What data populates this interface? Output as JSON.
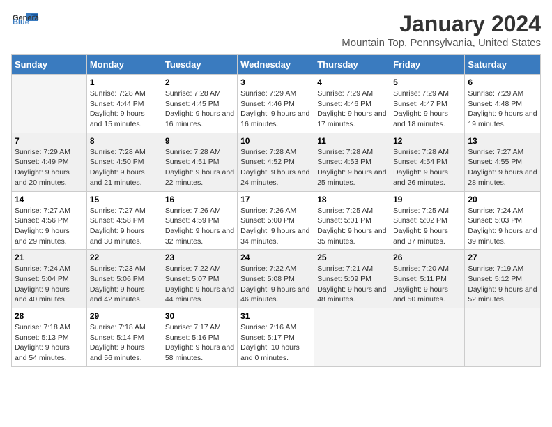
{
  "logo": {
    "general": "General",
    "blue": "Blue"
  },
  "title": "January 2024",
  "location": "Mountain Top, Pennsylvania, United States",
  "days_of_week": [
    "Sunday",
    "Monday",
    "Tuesday",
    "Wednesday",
    "Thursday",
    "Friday",
    "Saturday"
  ],
  "weeks": [
    [
      {
        "day": "",
        "empty": true
      },
      {
        "day": "1",
        "sunrise": "Sunrise: 7:28 AM",
        "sunset": "Sunset: 4:44 PM",
        "daylight": "Daylight: 9 hours and 15 minutes."
      },
      {
        "day": "2",
        "sunrise": "Sunrise: 7:28 AM",
        "sunset": "Sunset: 4:45 PM",
        "daylight": "Daylight: 9 hours and 16 minutes."
      },
      {
        "day": "3",
        "sunrise": "Sunrise: 7:29 AM",
        "sunset": "Sunset: 4:46 PM",
        "daylight": "Daylight: 9 hours and 16 minutes."
      },
      {
        "day": "4",
        "sunrise": "Sunrise: 7:29 AM",
        "sunset": "Sunset: 4:46 PM",
        "daylight": "Daylight: 9 hours and 17 minutes."
      },
      {
        "day": "5",
        "sunrise": "Sunrise: 7:29 AM",
        "sunset": "Sunset: 4:47 PM",
        "daylight": "Daylight: 9 hours and 18 minutes."
      },
      {
        "day": "6",
        "sunrise": "Sunrise: 7:29 AM",
        "sunset": "Sunset: 4:48 PM",
        "daylight": "Daylight: 9 hours and 19 minutes."
      }
    ],
    [
      {
        "day": "7",
        "sunrise": "Sunrise: 7:29 AM",
        "sunset": "Sunset: 4:49 PM",
        "daylight": "Daylight: 9 hours and 20 minutes."
      },
      {
        "day": "8",
        "sunrise": "Sunrise: 7:28 AM",
        "sunset": "Sunset: 4:50 PM",
        "daylight": "Daylight: 9 hours and 21 minutes."
      },
      {
        "day": "9",
        "sunrise": "Sunrise: 7:28 AM",
        "sunset": "Sunset: 4:51 PM",
        "daylight": "Daylight: 9 hours and 22 minutes."
      },
      {
        "day": "10",
        "sunrise": "Sunrise: 7:28 AM",
        "sunset": "Sunset: 4:52 PM",
        "daylight": "Daylight: 9 hours and 24 minutes."
      },
      {
        "day": "11",
        "sunrise": "Sunrise: 7:28 AM",
        "sunset": "Sunset: 4:53 PM",
        "daylight": "Daylight: 9 hours and 25 minutes."
      },
      {
        "day": "12",
        "sunrise": "Sunrise: 7:28 AM",
        "sunset": "Sunset: 4:54 PM",
        "daylight": "Daylight: 9 hours and 26 minutes."
      },
      {
        "day": "13",
        "sunrise": "Sunrise: 7:27 AM",
        "sunset": "Sunset: 4:55 PM",
        "daylight": "Daylight: 9 hours and 28 minutes."
      }
    ],
    [
      {
        "day": "14",
        "sunrise": "Sunrise: 7:27 AM",
        "sunset": "Sunset: 4:56 PM",
        "daylight": "Daylight: 9 hours and 29 minutes."
      },
      {
        "day": "15",
        "sunrise": "Sunrise: 7:27 AM",
        "sunset": "Sunset: 4:58 PM",
        "daylight": "Daylight: 9 hours and 30 minutes."
      },
      {
        "day": "16",
        "sunrise": "Sunrise: 7:26 AM",
        "sunset": "Sunset: 4:59 PM",
        "daylight": "Daylight: 9 hours and 32 minutes."
      },
      {
        "day": "17",
        "sunrise": "Sunrise: 7:26 AM",
        "sunset": "Sunset: 5:00 PM",
        "daylight": "Daylight: 9 hours and 34 minutes."
      },
      {
        "day": "18",
        "sunrise": "Sunrise: 7:25 AM",
        "sunset": "Sunset: 5:01 PM",
        "daylight": "Daylight: 9 hours and 35 minutes."
      },
      {
        "day": "19",
        "sunrise": "Sunrise: 7:25 AM",
        "sunset": "Sunset: 5:02 PM",
        "daylight": "Daylight: 9 hours and 37 minutes."
      },
      {
        "day": "20",
        "sunrise": "Sunrise: 7:24 AM",
        "sunset": "Sunset: 5:03 PM",
        "daylight": "Daylight: 9 hours and 39 minutes."
      }
    ],
    [
      {
        "day": "21",
        "sunrise": "Sunrise: 7:24 AM",
        "sunset": "Sunset: 5:04 PM",
        "daylight": "Daylight: 9 hours and 40 minutes."
      },
      {
        "day": "22",
        "sunrise": "Sunrise: 7:23 AM",
        "sunset": "Sunset: 5:06 PM",
        "daylight": "Daylight: 9 hours and 42 minutes."
      },
      {
        "day": "23",
        "sunrise": "Sunrise: 7:22 AM",
        "sunset": "Sunset: 5:07 PM",
        "daylight": "Daylight: 9 hours and 44 minutes."
      },
      {
        "day": "24",
        "sunrise": "Sunrise: 7:22 AM",
        "sunset": "Sunset: 5:08 PM",
        "daylight": "Daylight: 9 hours and 46 minutes."
      },
      {
        "day": "25",
        "sunrise": "Sunrise: 7:21 AM",
        "sunset": "Sunset: 5:09 PM",
        "daylight": "Daylight: 9 hours and 48 minutes."
      },
      {
        "day": "26",
        "sunrise": "Sunrise: 7:20 AM",
        "sunset": "Sunset: 5:11 PM",
        "daylight": "Daylight: 9 hours and 50 minutes."
      },
      {
        "day": "27",
        "sunrise": "Sunrise: 7:19 AM",
        "sunset": "Sunset: 5:12 PM",
        "daylight": "Daylight: 9 hours and 52 minutes."
      }
    ],
    [
      {
        "day": "28",
        "sunrise": "Sunrise: 7:18 AM",
        "sunset": "Sunset: 5:13 PM",
        "daylight": "Daylight: 9 hours and 54 minutes."
      },
      {
        "day": "29",
        "sunrise": "Sunrise: 7:18 AM",
        "sunset": "Sunset: 5:14 PM",
        "daylight": "Daylight: 9 hours and 56 minutes."
      },
      {
        "day": "30",
        "sunrise": "Sunrise: 7:17 AM",
        "sunset": "Sunset: 5:16 PM",
        "daylight": "Daylight: 9 hours and 58 minutes."
      },
      {
        "day": "31",
        "sunrise": "Sunrise: 7:16 AM",
        "sunset": "Sunset: 5:17 PM",
        "daylight": "Daylight: 10 hours and 0 minutes."
      },
      {
        "day": "",
        "empty": true
      },
      {
        "day": "",
        "empty": true
      },
      {
        "day": "",
        "empty": true
      }
    ]
  ]
}
